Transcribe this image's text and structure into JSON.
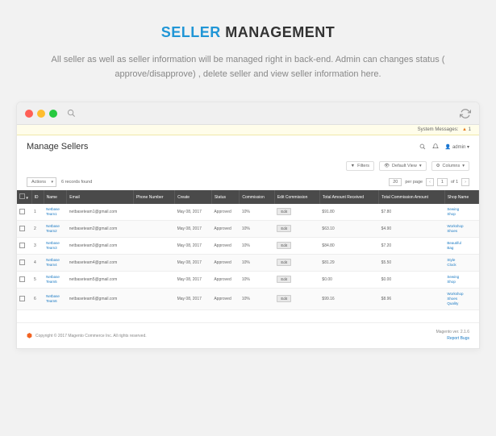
{
  "hero": {
    "title_blue": "SELLER",
    "title_dark": " MANAGEMENT",
    "desc": "All seller as well as seller information will be managed right in back-end. Admin can changes status ( approve/disapprove) , delete seller and view seller information here."
  },
  "sysmsg": {
    "label": "System Messages:",
    "count": "1"
  },
  "page": {
    "title": "Manage Sellers",
    "admin": "admin"
  },
  "toolbar": {
    "filters": "Filters",
    "default_view": "Default View",
    "columns": "Columns"
  },
  "actions": {
    "label": "Actions",
    "found": "6 records found",
    "perpage_val": "20",
    "perpage_label": "per page",
    "page": "1",
    "of": "of 1"
  },
  "headers": [
    "",
    "ID",
    "Name",
    "Email",
    "Phone Number",
    "Create",
    "Status",
    "Commission",
    "Edit Commission",
    "Total Amount Received",
    "Total Commission Amount",
    "Shop Name"
  ],
  "rows": [
    {
      "id": "1",
      "name": "Netbase Team1",
      "email": "netbaseteam1@gmail.com",
      "phone": "",
      "create": "May 08, 2017",
      "status": "Approved",
      "comm": "10%",
      "edit": "Edit",
      "total": "$91.80",
      "tcomm": "$7.80",
      "shop": "Sewing Shop"
    },
    {
      "id": "2",
      "name": "Netbase Team2",
      "email": "netbaseteam2@gmail.com",
      "phone": "",
      "create": "May 08, 2017",
      "status": "Approved",
      "comm": "10%",
      "edit": "Edit",
      "total": "$63.10",
      "tcomm": "$4.90",
      "shop": "Workshop Shoes"
    },
    {
      "id": "3",
      "name": "Netbase Team3",
      "email": "netbaseteam3@gmail.com",
      "phone": "",
      "create": "May 08, 2017",
      "status": "Approved",
      "comm": "10%",
      "edit": "Edit",
      "total": "$84.80",
      "tcomm": "$7.20",
      "shop": "Beautiful Bag"
    },
    {
      "id": "4",
      "name": "Netbase Team4",
      "email": "netbaseteam4@gmail.com",
      "phone": "",
      "create": "May 08, 2017",
      "status": "Approved",
      "comm": "10%",
      "edit": "Edit",
      "total": "$81.29",
      "tcomm": "$5.50",
      "shop": "Style Clock"
    },
    {
      "id": "5",
      "name": "Netbase Team5",
      "email": "netbaseteam5@gmail.com",
      "phone": "",
      "create": "May 08, 2017",
      "status": "Approved",
      "comm": "10%",
      "edit": "Edit",
      "total": "$0.00",
      "tcomm": "$0.00",
      "shop": "Sewing Shop"
    },
    {
      "id": "6",
      "name": "Netbase Team6",
      "email": "netbaseteam6@gmail.com",
      "phone": "",
      "create": "May 08, 2017",
      "status": "Approved",
      "comm": "10%",
      "edit": "Edit",
      "total": "$99.16",
      "tcomm": "$8.96",
      "shop": "Workshop Shoes Quality"
    }
  ],
  "footer": {
    "copyright": "Copyright © 2017 Magento Commerce Inc. All rights reserved.",
    "version": "Magento ver. 2.1.6",
    "bugs": "Report Bugs"
  }
}
